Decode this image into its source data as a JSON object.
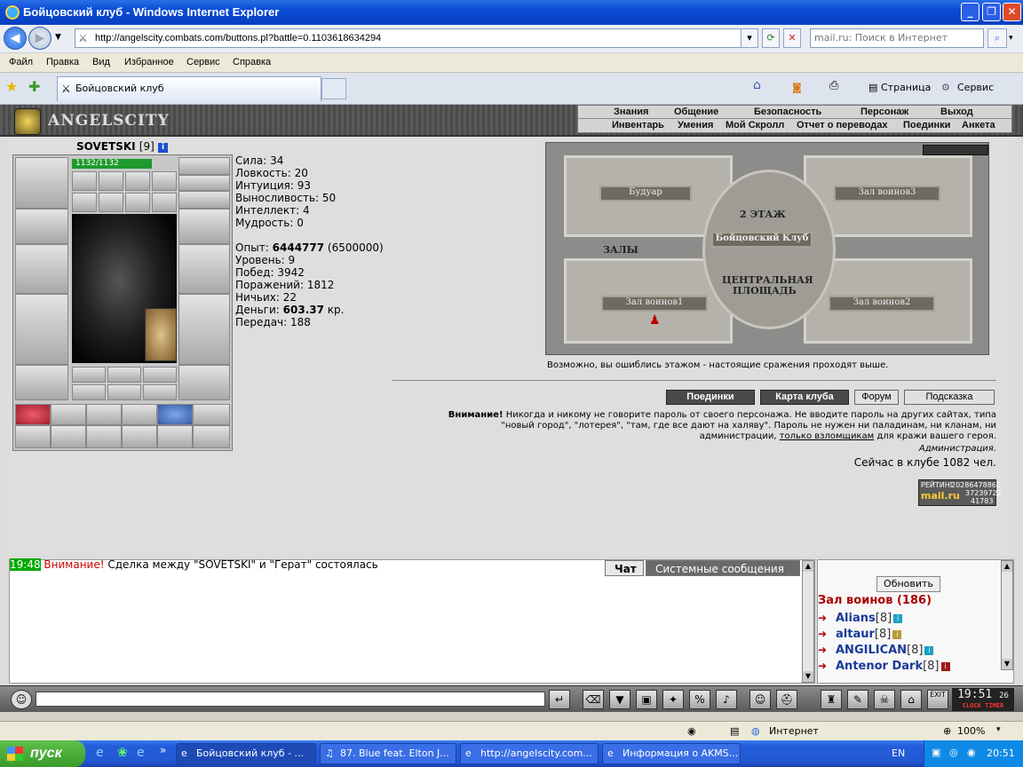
{
  "window": {
    "title": "Бойцовский клуб - Windows Internet Explorer",
    "minimize": "_",
    "maximize": "❐",
    "close": "✕"
  },
  "address": {
    "url": "http://angelscity.combats.com/buttons.pl?battle=0.1103618634294",
    "search_placeholder": "mail.ru: Поиск в Интернет"
  },
  "menu": [
    "Файл",
    "Правка",
    "Вид",
    "Избранное",
    "Сервис",
    "Справка"
  ],
  "tab": {
    "title": "Бойцовский клуб",
    "page_label": "Страница",
    "tools_label": "Сервис"
  },
  "game": {
    "logo": "ANGELSCITY",
    "nav_row1": [
      "Знания",
      "Общение",
      "Безопасность",
      "Персонаж",
      "Выход"
    ],
    "nav_row2": [
      "Инвентарь",
      "Умения",
      "Мой Скролл",
      "Отчет о переводах",
      "Поединки",
      "Анкета"
    ],
    "character": {
      "name": "SOVETSKI",
      "level": "[9]",
      "hp": "1132/1132"
    },
    "stats": [
      {
        "label": "Сила:",
        "value": "34"
      },
      {
        "label": "Ловкость:",
        "value": "20"
      },
      {
        "label": "Интуиция:",
        "value": "93"
      },
      {
        "label": "Выносливость:",
        "value": "50"
      },
      {
        "label": "Интеллект:",
        "value": "4"
      },
      {
        "label": "Мудрость:",
        "value": "0"
      }
    ],
    "experience": {
      "label": "Опыт:",
      "value": "6444777",
      "next": "(6500000)"
    },
    "record": [
      {
        "label": "Уровень:",
        "value": "9"
      },
      {
        "label": "Побед:",
        "value": "3942"
      },
      {
        "label": "Поражений:",
        "value": "1812"
      },
      {
        "label": "Ничьих:",
        "value": "22"
      }
    ],
    "money": {
      "label": "Деньги:",
      "value": "603.37",
      "unit": "кр."
    },
    "transfers": {
      "label": "Передач:",
      "value": "188"
    },
    "map": {
      "rooms": [
        "Будуар",
        "Зал воинов3",
        "2 ЭТАЖ",
        "Бойцовский Клуб",
        "ЗАЛЫ",
        "ЦЕНТРАЛЬНАЯ",
        "ПЛОЩАДЬ",
        "Зал воинов1",
        "Зал воинов2"
      ],
      "note": "Возможно, вы ошиблись этажом - настоящие сражения проходят выше."
    },
    "buttons": [
      "Поединки",
      "Карта клуба",
      "Форум",
      "Подсказка"
    ],
    "warning": {
      "bold": "Внимание!",
      "line1": " Никогда и никому не говорите пароль от своего персонажа. Не вводите пароль на других сайтах, типа",
      "line2": "\"новый город\", \"лотерея\", \"там, где все дают на халяву\". Пароль не нужен ни паладинам, ни кланам, ни",
      "line3a": "администрации, ",
      "line3u": "только взломщикам",
      "line3b": " для кражи вашего героя.",
      "admin": "Администрация."
    },
    "online": "Сейчас в клубе 1082 чел.",
    "rating": {
      "label": "РЕЙТИНГ",
      "brand": "mail.ru",
      "n1": "20286478862",
      "n2": "37239722",
      "n3": "41783"
    }
  },
  "chat": {
    "time": "19:48",
    "warning": "Внимание!",
    "message": " Сделка между \"SOVETSKI\" и \"Герат\" состоялась",
    "tabs": [
      "Чат",
      "Системные сообщения"
    ]
  },
  "room": {
    "refresh": "Обновить",
    "name": "Зал воинов (186)",
    "users": [
      {
        "name": "Alians",
        "level": "[8]"
      },
      {
        "name": "altaur",
        "level": "[8]"
      },
      {
        "name": "ANGILICAN",
        "level": "[8]"
      },
      {
        "name": "Antenor Dark",
        "level": "[8]"
      }
    ]
  },
  "clock": {
    "time": "19:51",
    "sec": "26",
    "label1": "CLOCK",
    "label2": "TIMER"
  },
  "statusbar": {
    "zone": "Интернет",
    "zoom": "100%"
  },
  "taskbar": {
    "start": "пуск",
    "items": [
      "Бойцовский клуб - ...",
      "87. Blue feat. Elton J...",
      "http://angelscity.com...",
      "Информация о AKMS..."
    ],
    "lang": "EN",
    "time": "20:51"
  },
  "colors": {
    "accent": "#0a4bd6",
    "hp": "#1e9a2e",
    "warning": "#cc0000",
    "room": "#aa0000"
  }
}
